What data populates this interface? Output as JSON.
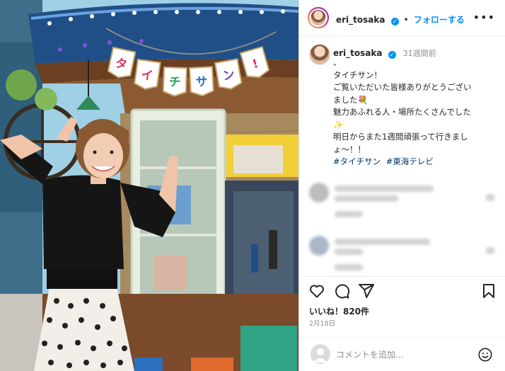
{
  "post": {
    "image_alt": "Woman pointing up at a banner that reads タイチサン!",
    "banner_chars": [
      "タ",
      "イ",
      "チ",
      "サ",
      "ン",
      "!"
    ]
  },
  "header": {
    "username": "eri_tosaka",
    "separator": "•",
    "follow_label": "フォローする",
    "more_icon": "more-horizontal-icon"
  },
  "caption": {
    "username": "eri_tosaka",
    "time_ago": "31週間前",
    "text": "、\nタイチサン！\nご覧いただいた皆様ありがとうござい\nました💐\n魅力あふれる人・場所たくさんでした\n✨\n明日からまた1週間頑張って行きまし\nょ〜！！",
    "hashtags": [
      "#タイチサン",
      "#東海テレビ"
    ]
  },
  "actions": {
    "like_icon": "heart-icon",
    "comment_icon": "comment-icon",
    "share_icon": "send-icon",
    "save_icon": "bookmark-icon",
    "likes_text": "いいね！820件",
    "date": "2月18日"
  },
  "comment_box": {
    "placeholder": "コメントを追加...",
    "emoji_icon": "smiley-icon"
  },
  "colors": {
    "link_blue": "#0095f6",
    "hashtag_blue": "#00376b",
    "muted": "#8e8e8e",
    "text": "#262626"
  }
}
